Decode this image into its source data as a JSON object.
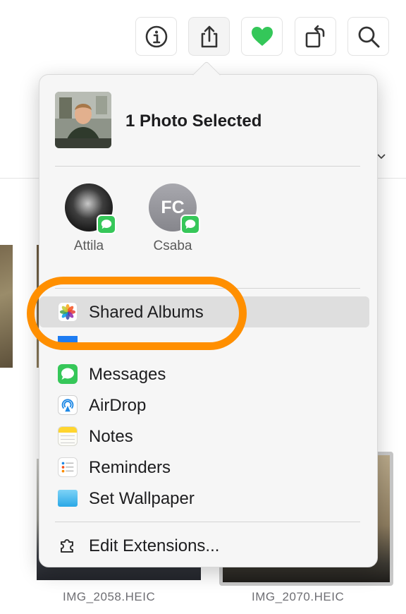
{
  "toolbar": {
    "buttons": [
      {
        "name": "info",
        "icon": "info-icon"
      },
      {
        "name": "share",
        "icon": "share-icon"
      },
      {
        "name": "favorite",
        "icon": "heart-icon"
      },
      {
        "name": "rotate",
        "icon": "rotate-icon"
      },
      {
        "name": "search",
        "icon": "search-icon"
      }
    ]
  },
  "popover": {
    "title": "1 Photo Selected",
    "people": [
      {
        "name": "Attila",
        "icon": "messages-icon"
      },
      {
        "name": "Csaba",
        "initials": "FC",
        "icon": "messages-icon"
      }
    ],
    "menu": [
      {
        "label": "Shared Albums",
        "icon": "photos-icon",
        "highlighted": true
      },
      {
        "label": "Messages",
        "icon": "messages-icon"
      },
      {
        "label": "AirDrop",
        "icon": "airdrop-icon"
      },
      {
        "label": "Notes",
        "icon": "notes-icon"
      },
      {
        "label": "Reminders",
        "icon": "reminders-icon"
      },
      {
        "label": "Set Wallpaper",
        "icon": "wallpaper-icon"
      }
    ],
    "edit_extensions": "Edit Extensions..."
  },
  "grid": {
    "filenames": [
      "IMG_2058.HEIC",
      "IMG_2070.HEIC"
    ]
  },
  "colors": {
    "accent_orange": "#ff8f00",
    "favorite_green": "#34c759",
    "messages_green": "#36c759",
    "highlight": "#dedede"
  }
}
